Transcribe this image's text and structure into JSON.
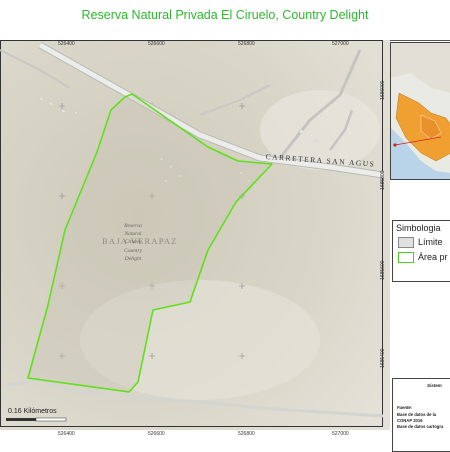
{
  "title": "Reserva Natural Privada El Ciruelo, Country Delight",
  "map": {
    "top_coords": [
      "526400",
      "526600",
      "526800",
      "527000"
    ],
    "bottom_coords": [
      "526400",
      "526600",
      "526800",
      "527000"
    ],
    "right_coords": [
      "1686000",
      "1685800",
      "1685600",
      "1685400"
    ],
    "road_label": "CARRETERA SAN AGUS",
    "department_label": "BAJA VERAPAZ",
    "reserve_label": [
      "Reserva",
      "Natural",
      "Ciruelo",
      "Country",
      "Delight"
    ],
    "scale_label": "0.16 Kilómetros"
  },
  "legend": {
    "title": "Simbologia",
    "items": [
      {
        "label": "Límite",
        "type": "limit"
      },
      {
        "label": "Área pr",
        "type": "area"
      }
    ]
  },
  "source": {
    "heading": "Sistem",
    "lines": [
      "Fuente:",
      "Base de datos de la",
      "CONAP 2016",
      "Base de datos cartogra"
    ]
  },
  "colors": {
    "title": "#2eb82e",
    "reserve_outline": "#5fe01a",
    "terrain": "#d8d4c6",
    "road": "#bdbdbd"
  }
}
